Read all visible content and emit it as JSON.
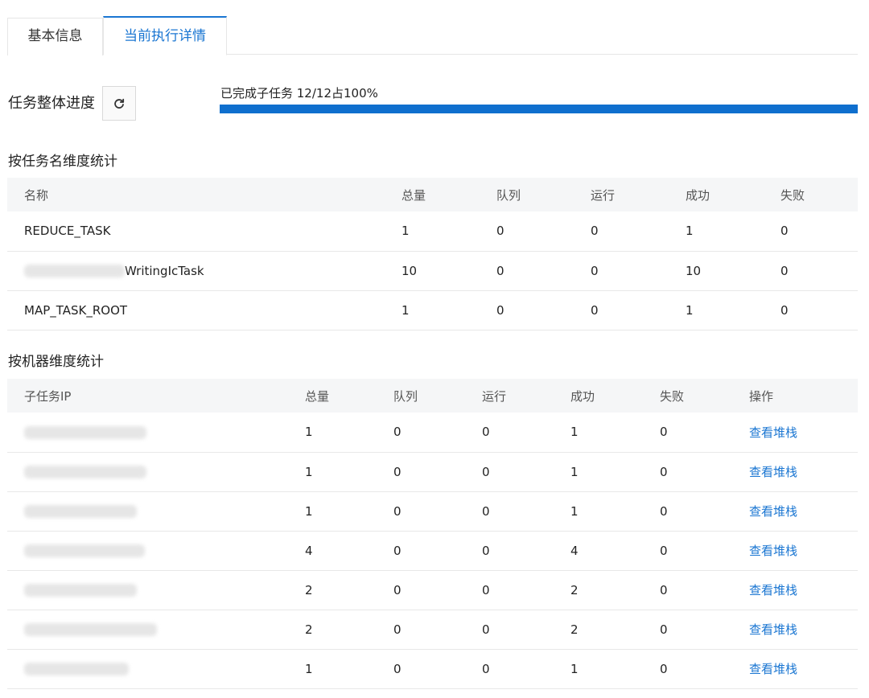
{
  "tabs": [
    {
      "label": "基本信息",
      "active": false
    },
    {
      "label": "当前执行详情",
      "active": true
    }
  ],
  "progress": {
    "title": "任务整体进度",
    "refresh_icon": "refresh-icon",
    "text": "已完成子任务 12/12占100%",
    "percent": 100,
    "fill_color": "#0f6fce"
  },
  "task_table": {
    "title": "按任务名维度统计",
    "headers": [
      "名称",
      "总量",
      "队列",
      "运行",
      "成功",
      "失败"
    ],
    "rows": [
      {
        "name": "REDUCE_TASK",
        "total": "1",
        "queue": "0",
        "running": "0",
        "success": "1",
        "failed": "0"
      },
      {
        "name": "WritingIcTask",
        "total": "10",
        "queue": "0",
        "running": "0",
        "success": "10",
        "failed": "0"
      },
      {
        "name": "MAP_TASK_ROOT",
        "total": "1",
        "queue": "0",
        "running": "0",
        "success": "1",
        "failed": "0"
      }
    ]
  },
  "machine_table": {
    "title": "按机器维度统计",
    "headers": [
      "子任务IP",
      "总量",
      "队列",
      "运行",
      "成功",
      "失败",
      "操作"
    ],
    "action_label": "查看堆栈",
    "rows": [
      {
        "total": "1",
        "queue": "0",
        "running": "0",
        "success": "1",
        "failed": "0"
      },
      {
        "total": "1",
        "queue": "0",
        "running": "0",
        "success": "1",
        "failed": "0"
      },
      {
        "total": "1",
        "queue": "0",
        "running": "0",
        "success": "1",
        "failed": "0"
      },
      {
        "total": "4",
        "queue": "0",
        "running": "0",
        "success": "4",
        "failed": "0"
      },
      {
        "total": "2",
        "queue": "0",
        "running": "0",
        "success": "2",
        "failed": "0"
      },
      {
        "total": "2",
        "queue": "0",
        "running": "0",
        "success": "2",
        "failed": "0"
      },
      {
        "total": "1",
        "queue": "0",
        "running": "0",
        "success": "1",
        "failed": "0"
      }
    ]
  }
}
